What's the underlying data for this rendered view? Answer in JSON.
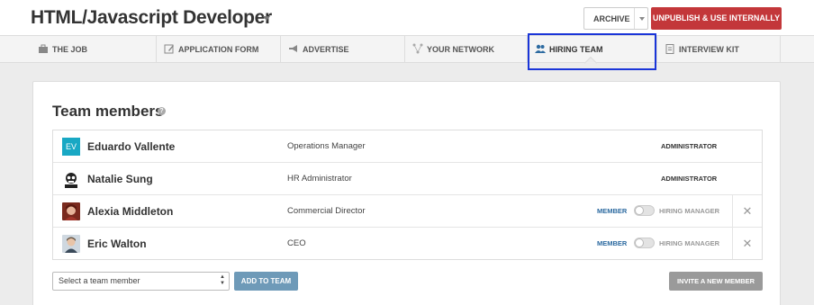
{
  "header": {
    "title": "HTML/Javascript Developer",
    "archive_label": "ARCHIVE",
    "unpublish_label": "UNPUBLISH & USE INTERNALLY"
  },
  "tabs": [
    {
      "label": "THE JOB",
      "icon": "briefcase-icon"
    },
    {
      "label": "APPLICATION FORM",
      "icon": "edit-form-icon"
    },
    {
      "label": "ADVERTISE",
      "icon": "megaphone-icon"
    },
    {
      "label": "YOUR NETWORK",
      "icon": "network-icon"
    },
    {
      "label": "HIRING TEAM",
      "icon": "people-icon",
      "active": true
    },
    {
      "label": "INTERVIEW KIT",
      "icon": "clipboard-icon"
    }
  ],
  "team": {
    "title": "Team members",
    "help_icon": "?",
    "members": [
      {
        "initials": "EV",
        "name": "Eduardo Vallente",
        "job_title": "Operations Manager",
        "role": "ADMINISTRATOR"
      },
      {
        "name": "Natalie Sung",
        "job_title": "HR Administrator",
        "role": "ADMINISTRATOR"
      },
      {
        "name": "Alexia Middleton",
        "job_title": "Commercial Director",
        "role_member": "MEMBER",
        "role_hiring": "HIRING MANAGER",
        "toggle_on": false
      },
      {
        "name": "Eric Walton",
        "job_title": "CEO",
        "role_member": "MEMBER",
        "role_hiring": "HIRING MANAGER",
        "toggle_on": false
      }
    ],
    "remove_glyph": "✕",
    "select_placeholder": "Select a team member",
    "add_label": "ADD TO TEAM",
    "invite_label": "INVITE A NEW MEMBER"
  },
  "colors": {
    "accent_red": "#c3373a",
    "highlight_blue": "#1a35d8",
    "member_blue": "#2c6aa0",
    "add_button": "#6e9ab8"
  }
}
